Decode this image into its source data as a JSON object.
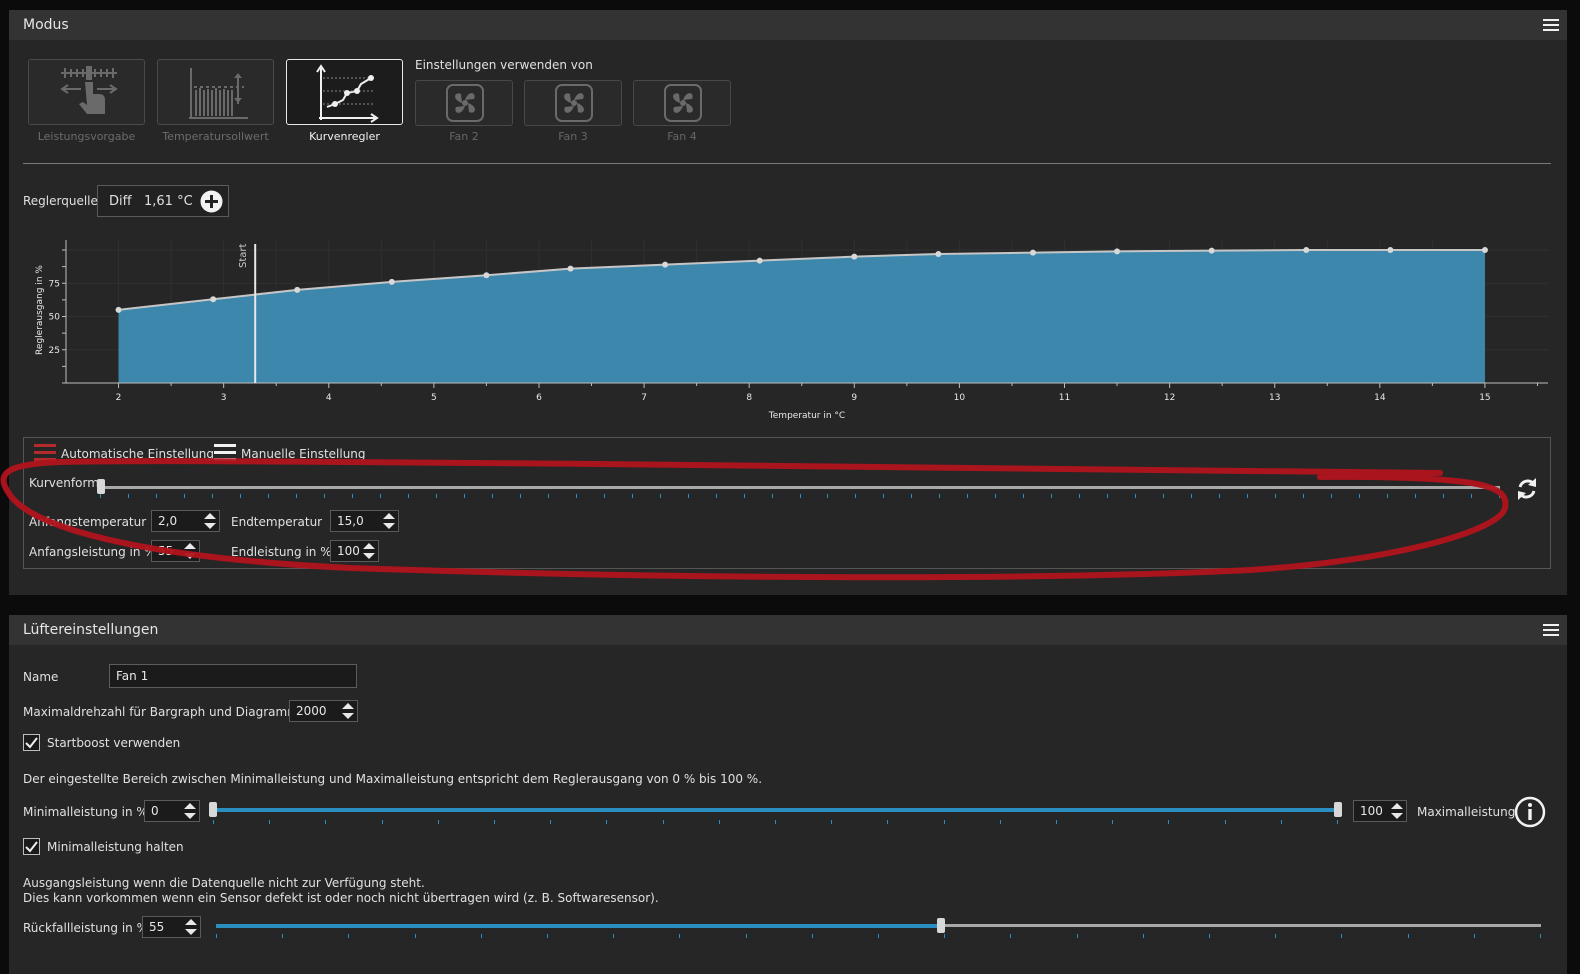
{
  "mode_panel": {
    "title": "Modus",
    "modes": [
      {
        "label": "Leistungsvorgabe",
        "icon": "manual-control-icon"
      },
      {
        "label": "Temperatursollwert",
        "icon": "bar-target-icon"
      },
      {
        "label": "Kurvenregler",
        "icon": "curve-chart-icon"
      }
    ],
    "settings_from_label": "Einstellungen verwenden von",
    "fans": [
      {
        "label": "Fan 2"
      },
      {
        "label": "Fan 3"
      },
      {
        "label": "Fan 4"
      }
    ],
    "source": {
      "label": "Reglerquelle",
      "name": "Diff",
      "value": "1,61 °C"
    }
  },
  "chart_data": {
    "type": "area",
    "xlabel": "Temperatur in °C",
    "ylabel": "Reglerausgang in %",
    "xlim": [
      1.5,
      15.6
    ],
    "ylim": [
      0,
      100
    ],
    "x_ticks": [
      2,
      3,
      4,
      5,
      6,
      7,
      8,
      9,
      10,
      11,
      12,
      13,
      14,
      15
    ],
    "y_ticks": [
      25,
      50,
      75
    ],
    "grid": true,
    "start_marker": {
      "label": "Start",
      "x": 3.3
    },
    "x": [
      2,
      2.9,
      3.7,
      4.6,
      5.5,
      6.3,
      7.2,
      8.1,
      9.0,
      9.8,
      10.7,
      11.5,
      12.4,
      13.3,
      14.1,
      15
    ],
    "values": [
      55,
      63,
      70,
      76,
      81,
      86,
      89,
      92,
      95,
      97,
      98,
      99,
      99.5,
      100,
      100,
      100
    ],
    "fill_color": "#3e87ac",
    "line_color": "#c6c6c6"
  },
  "curve_settings": {
    "auto_label": "Automatische Einstellung",
    "manual_label": "Manuelle Einstellung",
    "shape_label": "Kurvenform",
    "shape_value": 0,
    "start_temp_label": "Anfangstemperatur",
    "start_temp": "2,0",
    "end_temp_label": "Endtemperatur",
    "end_temp": "15,0",
    "start_power_label": "Anfangsleistung in %",
    "start_power": "55",
    "end_power_label": "Endleistung in %",
    "end_power": "100",
    "annotation_color": "#b0131c"
  },
  "fan_panel": {
    "title": "Lüftereinstellungen",
    "name_label": "Name",
    "name_value": "Fan 1",
    "maxrpm_label": "Maximaldrehzahl für Bargraph und Diagramm",
    "maxrpm_value": "2000",
    "startboost_label": "Startboost verwenden",
    "startboost_checked": true,
    "range_note": "Der eingestellte Bereich zwischen Minimalleistung und Maximalleistung entspricht dem Reglerausgang von 0 % bis 100 %.",
    "min_label": "Minimalleistung in %",
    "min_value": "0",
    "max_value": "100",
    "max_label": "Maximalleistung",
    "hold_min_label": "Minimalleistung halten",
    "hold_min_checked": true,
    "fallback_note1": "Ausgangsleistung wenn die Datenquelle nicht zur Verfügung steht.",
    "fallback_note2": "Dies kann vorkommen wenn ein Sensor defekt ist oder noch nicht übertragen wird (z. B. Softwaresensor).",
    "fallback_label": "Rückfallleistung in %",
    "fallback_value": "55",
    "fallback_level_percent": 55
  },
  "accent_color": "#2a8fc0"
}
